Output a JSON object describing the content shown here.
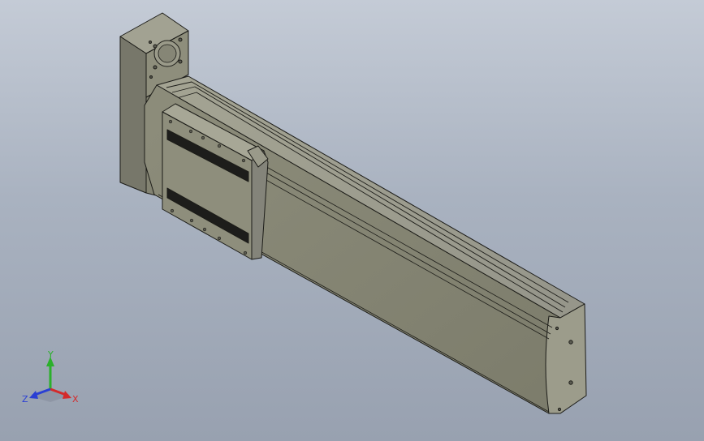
{
  "viewport": {
    "background_top": "#c4cbd6",
    "background_bottom": "#98a1b0",
    "model_color": "#8a8a78",
    "edge_color": "#1c1c18"
  },
  "triad": {
    "x_label": "X",
    "y_label": "Y",
    "z_label": "Z",
    "x_color": "#d42a2a",
    "y_color": "#2bb02b",
    "z_color": "#2a3fd4"
  }
}
